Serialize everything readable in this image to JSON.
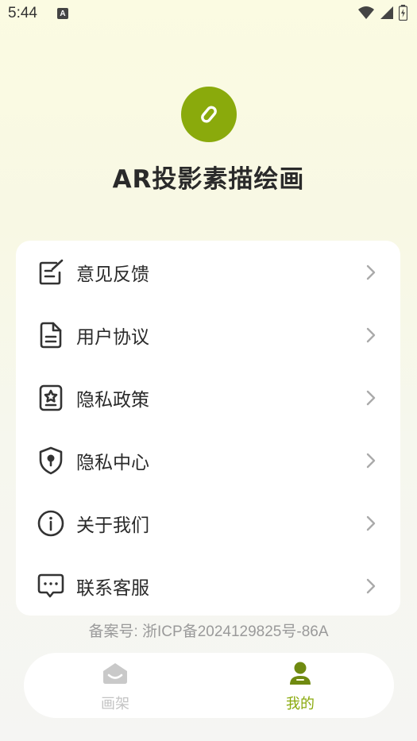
{
  "status_bar": {
    "time": "5:44",
    "app_icon_letter": "A"
  },
  "app": {
    "title": "AR投影素描绘画",
    "logo_icon": "pencil-icon",
    "brand_color": "#8aaa0c"
  },
  "menu": {
    "items": [
      {
        "label": "意见反馈",
        "icon": "feedback-icon"
      },
      {
        "label": "用户协议",
        "icon": "document-icon"
      },
      {
        "label": "隐私政策",
        "icon": "star-badge-icon"
      },
      {
        "label": "隐私中心",
        "icon": "shield-lock-icon"
      },
      {
        "label": "关于我们",
        "icon": "info-icon"
      },
      {
        "label": "联系客服",
        "icon": "chat-icon"
      }
    ]
  },
  "footer": {
    "icp": "备案号: 浙ICP备2024129825号-86A"
  },
  "tab_bar": {
    "tabs": [
      {
        "label": "画架",
        "icon": "easel-icon",
        "active": false,
        "color": "#c4c4c4"
      },
      {
        "label": "我的",
        "icon": "person-icon",
        "active": true,
        "color": "#8aaa0c"
      }
    ]
  }
}
